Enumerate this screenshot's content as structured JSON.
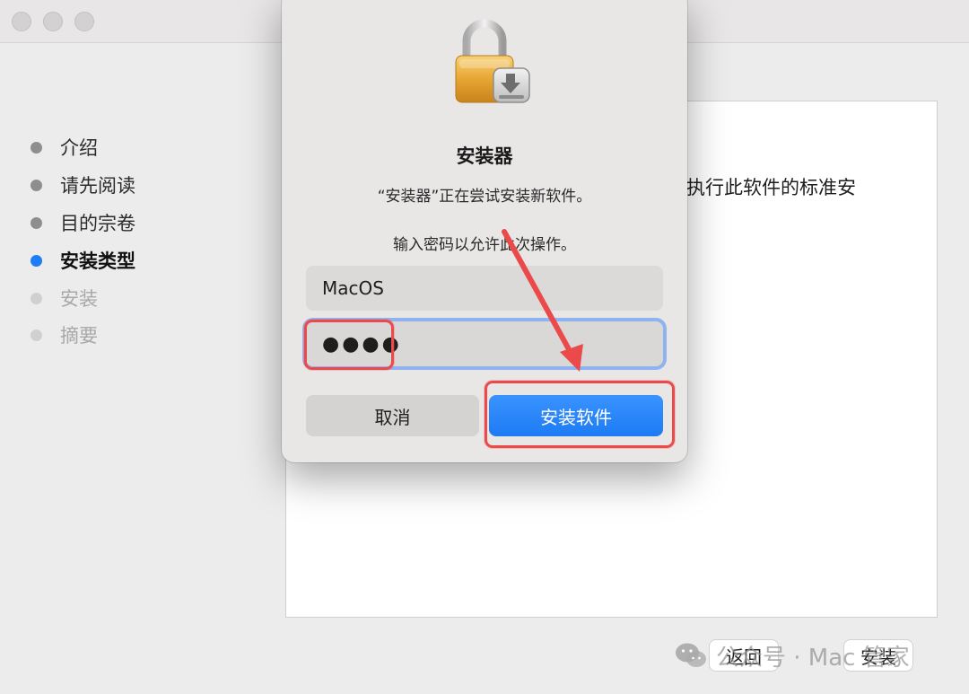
{
  "window": {
    "steps": [
      {
        "label": "介绍",
        "state": "done"
      },
      {
        "label": "请先阅读",
        "state": "done"
      },
      {
        "label": "目的宗卷",
        "state": "done"
      },
      {
        "label": "安装类型",
        "state": "active"
      },
      {
        "label": "安装",
        "state": "future"
      },
      {
        "label": "摘要",
        "state": "future"
      }
    ],
    "content_text": "执行此软件的标准安",
    "footer": {
      "back_label": "返回",
      "install_label": "安装"
    }
  },
  "dialog": {
    "title": "安装器",
    "message": "“安装器”正在尝试安装新软件。",
    "prompt": "输入密码以允许此次操作。",
    "username_value": "MacOS",
    "password_value": "●●●●",
    "cancel_label": "取消",
    "confirm_label": "安装软件"
  },
  "watermark": {
    "text": "公众号 · Mac 管家"
  },
  "colors": {
    "accent": "#1f7ef5",
    "annotation": "#ea4a4a",
    "focus_ring": "#8fb2f0"
  }
}
